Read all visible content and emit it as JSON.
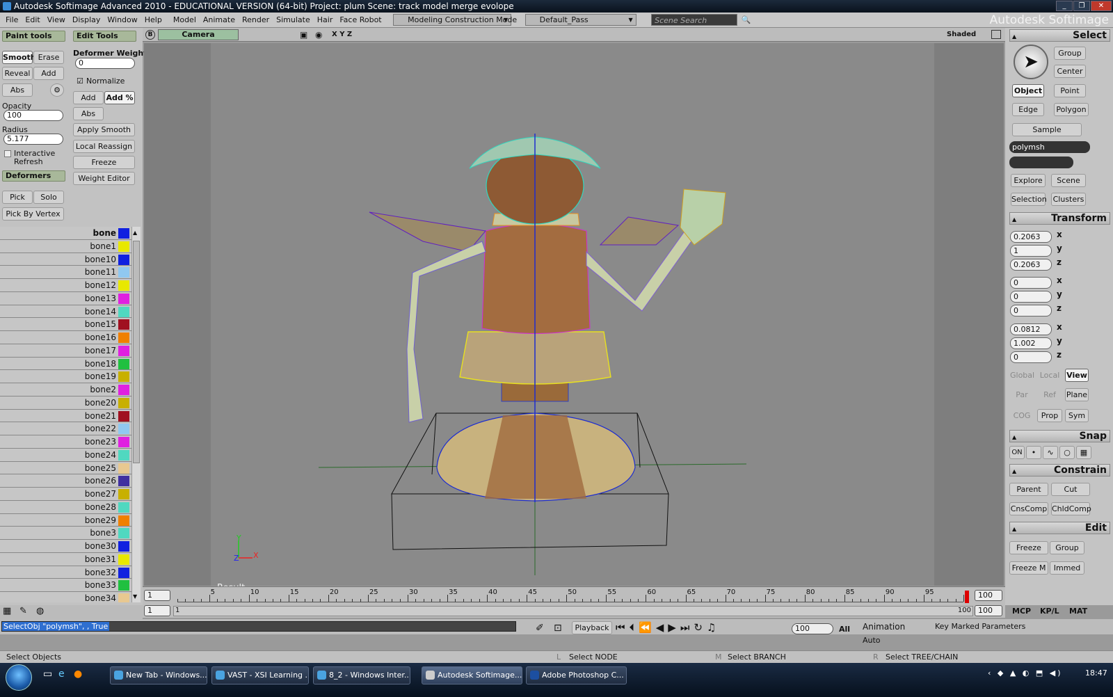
{
  "window": {
    "title": "Autodesk Softimage Advanced 2010 - EDUCATIONAL VERSION (64-bit)   Project: plum   Scene: track model merge evolope"
  },
  "menu": {
    "items": [
      "File",
      "Edit",
      "View",
      "Display",
      "Window",
      "Help",
      "Model",
      "Animate",
      "Render",
      "Simulate",
      "Hair",
      "Face Robot"
    ],
    "mode": "Modeling Construction Mode",
    "pass": "Default_Pass",
    "search_placeholder": "Scene Search",
    "brand": "Autodesk Softimage"
  },
  "left": {
    "paint_tools": "Paint tools",
    "edit_tools": "Edit Tools",
    "smooth": "Smooth",
    "erase": "Erase",
    "reveal": "Reveal",
    "add": "Add",
    "abs": "Abs",
    "opacity_label": "Opacity",
    "opacity_value": "100",
    "radius_label": "Radius",
    "radius_value": "5.177",
    "interactive_refresh": "Interactive Refresh",
    "deformers": "Deformers",
    "pick": "Pick",
    "solo": "Solo",
    "pick_by_vertex": "Pick By Vertex",
    "deformer_weight": "Deformer Weight",
    "deformer_weight_value": "0",
    "normalize": "Normalize",
    "add2": "Add",
    "add_pct": "Add %",
    "abs2": "Abs",
    "apply_smooth": "Apply Smooth",
    "local_reassign": "Local Reassign",
    "freeze": "Freeze",
    "weight_editor": "Weight Editor",
    "bones": [
      {
        "name": "bone",
        "color": "#1020e0"
      },
      {
        "name": "bone1",
        "color": "#e8e800"
      },
      {
        "name": "bone10",
        "color": "#1020e0"
      },
      {
        "name": "bone11",
        "color": "#90c8f0"
      },
      {
        "name": "bone12",
        "color": "#e8e800"
      },
      {
        "name": "bone13",
        "color": "#e020e0"
      },
      {
        "name": "bone14",
        "color": "#50d8c0"
      },
      {
        "name": "bone15",
        "color": "#a01020"
      },
      {
        "name": "bone16",
        "color": "#f08000"
      },
      {
        "name": "bone17",
        "color": "#e020e0"
      },
      {
        "name": "bone18",
        "color": "#20c040"
      },
      {
        "name": "bone19",
        "color": "#c8b000"
      },
      {
        "name": "bone2",
        "color": "#e020e0"
      },
      {
        "name": "bone20",
        "color": "#c8b000"
      },
      {
        "name": "bone21",
        "color": "#a01020"
      },
      {
        "name": "bone22",
        "color": "#90c8f0"
      },
      {
        "name": "bone23",
        "color": "#e020e0"
      },
      {
        "name": "bone24",
        "color": "#50d8c0"
      },
      {
        "name": "bone25",
        "color": "#e8c890"
      },
      {
        "name": "bone26",
        "color": "#4030a0"
      },
      {
        "name": "bone27",
        "color": "#c8b000"
      },
      {
        "name": "bone28",
        "color": "#50d8c0"
      },
      {
        "name": "bone29",
        "color": "#f08000"
      },
      {
        "name": "bone3",
        "color": "#50d8c0"
      },
      {
        "name": "bone30",
        "color": "#1020e0"
      },
      {
        "name": "bone31",
        "color": "#e8e800"
      },
      {
        "name": "bone32",
        "color": "#1020e0"
      },
      {
        "name": "bone33",
        "color": "#20c040"
      },
      {
        "name": "bone34",
        "color": "#e8c890"
      }
    ]
  },
  "viewport": {
    "camera": "Camera",
    "axes": "X Y Z",
    "mode": "Shaded",
    "result": "Result",
    "axis_y": "Y",
    "axis_x": "X",
    "axis_z": "Z"
  },
  "right": {
    "select": "Select",
    "group": "Group",
    "center": "Center",
    "object": "Object",
    "point": "Point",
    "edge": "Edge",
    "polygon": "Polygon",
    "sample": "Sample",
    "selected_name": "polymsh",
    "explore": "Explore",
    "scene": "Scene",
    "selection": "Selection",
    "clusters": "Clusters",
    "transform": "Transform",
    "scale": [
      "0.2063",
      "1",
      "0.2063"
    ],
    "rotate": [
      "0",
      "0",
      "0"
    ],
    "translate": [
      "0.0812",
      "1.002",
      "0"
    ],
    "global": "Global",
    "local": "Local",
    "view": "View",
    "par": "Par",
    "ref": "Ref",
    "plane": "Plane",
    "cog": "COG",
    "prop": "Prop",
    "sym": "Sym",
    "snap": "Snap",
    "on": "ON",
    "constrain": "Constrain",
    "parent": "Parent",
    "cut": "Cut",
    "cnscomp": "CnsComp",
    "chldcomp": "ChldComp",
    "edit": "Edit",
    "freeze": "Freeze",
    "group2": "Group",
    "freeze_m": "Freeze M",
    "immed": "Immed",
    "mcp": "MCP",
    "kpl": "KP/L",
    "mat": "MAT"
  },
  "timeline": {
    "start": "1",
    "end": "100",
    "ticks": [
      "5",
      "10",
      "15",
      "20",
      "25",
      "30",
      "35",
      "40",
      "45",
      "50",
      "55",
      "60",
      "65",
      "70",
      "75",
      "80",
      "85",
      "90",
      "95"
    ],
    "range_start": "1",
    "range_label": "1",
    "range_end_label": "100",
    "range_end": "100"
  },
  "command": {
    "text": "SelectObj \"polymsh\", , True",
    "playback": "Playback",
    "frame": "100",
    "all": "All",
    "animation": "Animation",
    "auto": "Auto",
    "key_marked": "Key Marked Parameters"
  },
  "status": {
    "left": "Select Objects",
    "l_key": "L",
    "l_text": "Select NODE",
    "m_key": "M",
    "m_text": "Select BRANCH",
    "r_key": "R",
    "r_text": "Select TREE/CHAIN"
  },
  "taskbar": {
    "tasks": [
      "New Tab - Windows...",
      "VAST - XSI Learning ...",
      "8_2 - Windows Inter...",
      "Autodesk Softimage...",
      "Adobe Photoshop C..."
    ],
    "time": "18:47"
  }
}
